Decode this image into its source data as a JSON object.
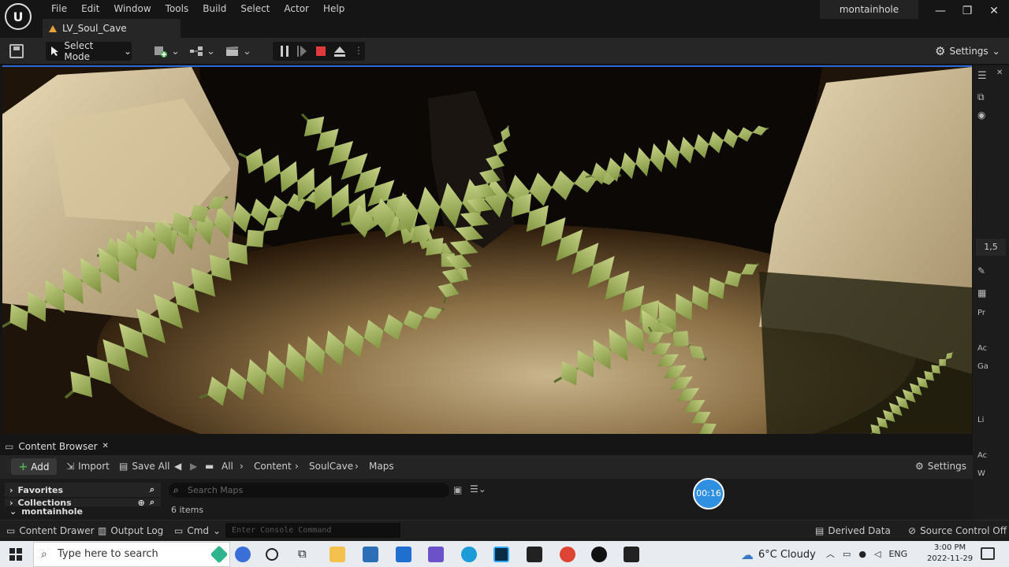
{
  "app": {
    "menu": [
      "File",
      "Edit",
      "Window",
      "Tools",
      "Build",
      "Select",
      "Actor",
      "Help"
    ],
    "project_name": "montainhole",
    "level_tab": "LV_Soul_Cave",
    "window_controls": {
      "minimize": "—",
      "maximize": "❐",
      "close": "✕"
    }
  },
  "toolbar": {
    "select_mode": "Select Mode",
    "settings": "Settings",
    "icons": [
      "save-icon",
      "add-content-icon",
      "blueprint-icon",
      "cinematics-icon",
      "pause-icon",
      "step-icon",
      "stop-icon",
      "eject-icon"
    ]
  },
  "viewport": {
    "scene": "cave with ferns and rocks"
  },
  "right_panel": {
    "zoom": "1,5",
    "labels": [
      "Pr",
      "Ac",
      "Ga",
      "Li",
      "Ac",
      "W"
    ]
  },
  "content_browser": {
    "tab": "Content Browser",
    "add": "Add",
    "import": "Import",
    "save_all": "Save All",
    "breadcrumb": [
      "All",
      "Content",
      "SoulCave",
      "Maps"
    ],
    "settings": "Settings",
    "favorites": "Favorites",
    "collections": "Collections",
    "project": "montainhole",
    "search_placeholder": "Search Maps",
    "items_count": "6 items",
    "timer": "00:16"
  },
  "statusbar": {
    "content_drawer": "Content Drawer",
    "output_log": "Output Log",
    "cmd": "Cmd",
    "console_placeholder": "Enter Console Command",
    "derived_data": "Derived Data",
    "source_control": "Source Control Off"
  },
  "taskbar": {
    "search_placeholder": "Type here to search",
    "weather": "6°C  Cloudy",
    "language": "ENG",
    "time": "3:00 PM",
    "date": "2022-11-29"
  },
  "colors": {
    "accent_blue": "#2b6ad6",
    "stop_red": "#e03a3a",
    "warning_orange": "#e8a33a",
    "add_green": "#4caf50"
  }
}
